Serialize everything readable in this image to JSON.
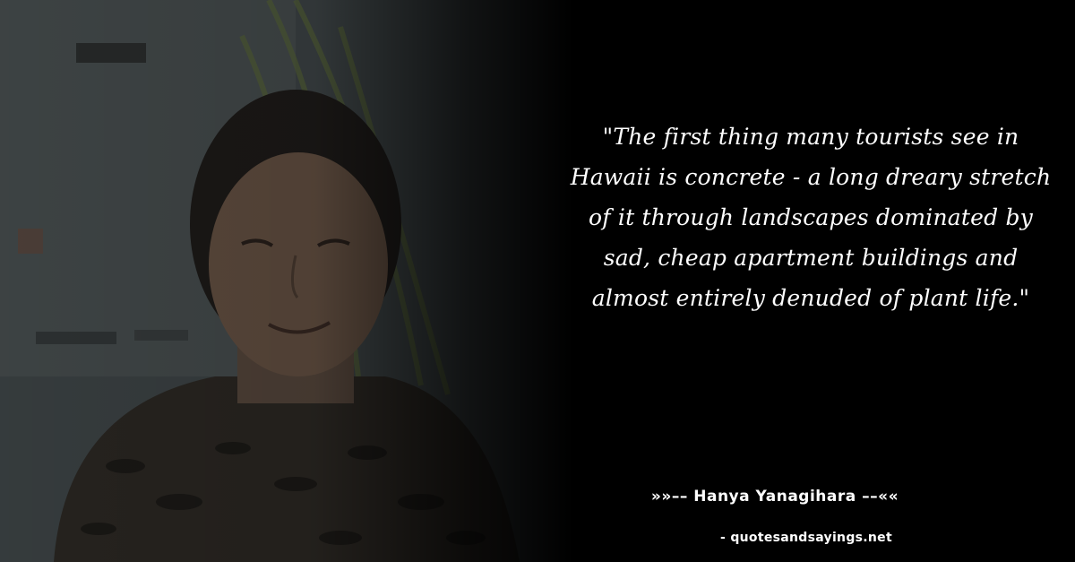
{
  "quote": {
    "text": "\"The first thing many tourists see in Hawaii is concrete - a long dreary stretch of it through landscapes dominated by sad, cheap apartment buildings and almost entirely denuded of plant life.\""
  },
  "attribution": {
    "author_line": "»»–– Hanya Yanagihara ––««",
    "source": "- quotesandsayings.net"
  },
  "photo": {
    "subject": "portrait-photo",
    "background_color": "#3a3e40"
  },
  "colors": {
    "background": "#000000",
    "text": "#ffffff"
  }
}
